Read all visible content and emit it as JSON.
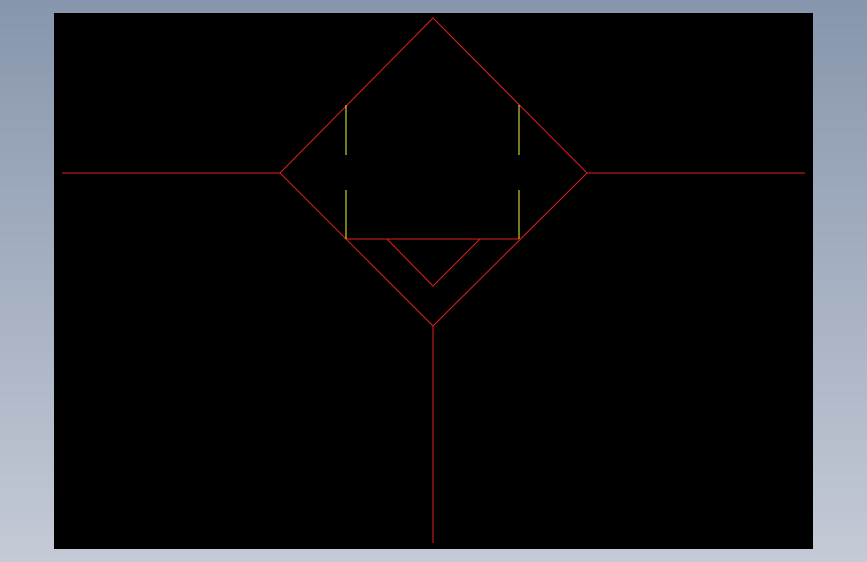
{
  "colors": {
    "background_gradient_top": "#8796ad",
    "background_gradient_bottom": "#c4cad6",
    "canvas": "#000000",
    "red_line": "#e41e1e",
    "yellow_line": "#f2f23c"
  },
  "drawing": {
    "description_visible_text": ""
  }
}
